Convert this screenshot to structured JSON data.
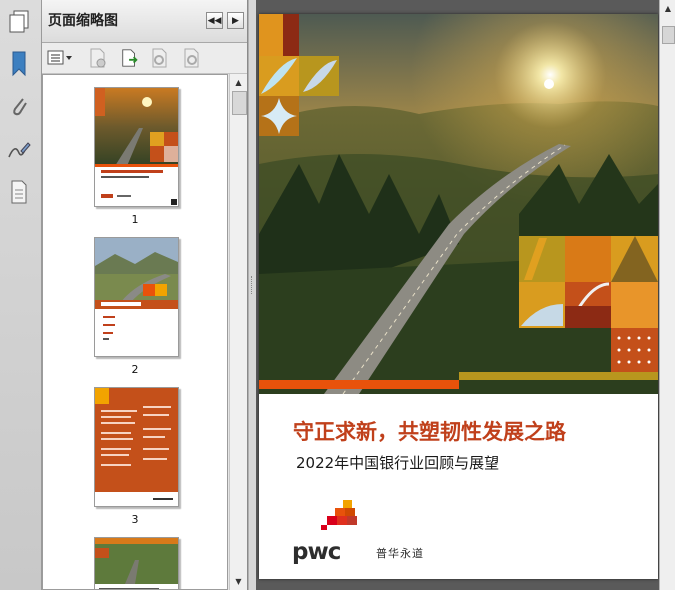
{
  "panel": {
    "title": "页面缩略图",
    "collapse_icon": "double-chevron-left-icon",
    "expand_icon": "chevron-right-icon"
  },
  "rail": {
    "icons": [
      "pages-icon",
      "bookmark-icon",
      "attachment-icon",
      "signature-icon",
      "layers-icon"
    ]
  },
  "toolbar": {
    "icons": [
      "options-menu-icon",
      "delete-page-icon",
      "insert-page-icon",
      "extract-page-icon",
      "replace-page-icon"
    ]
  },
  "thumbnails": [
    {
      "label": "1",
      "selected": true
    },
    {
      "label": "2",
      "selected": false
    },
    {
      "label": "3",
      "selected": false
    }
  ],
  "document": {
    "title": "守正求新，共塑韧性发展之路",
    "subtitle": "2022年中国银行业回顾与展望",
    "brand": "pwc",
    "brand_cn": "普华永道"
  },
  "colors": {
    "accent": "#c0401b",
    "orange": "#e8520b",
    "gold": "#d99c1f",
    "mustard": "#b8961e",
    "maroon": "#8c2a14"
  }
}
